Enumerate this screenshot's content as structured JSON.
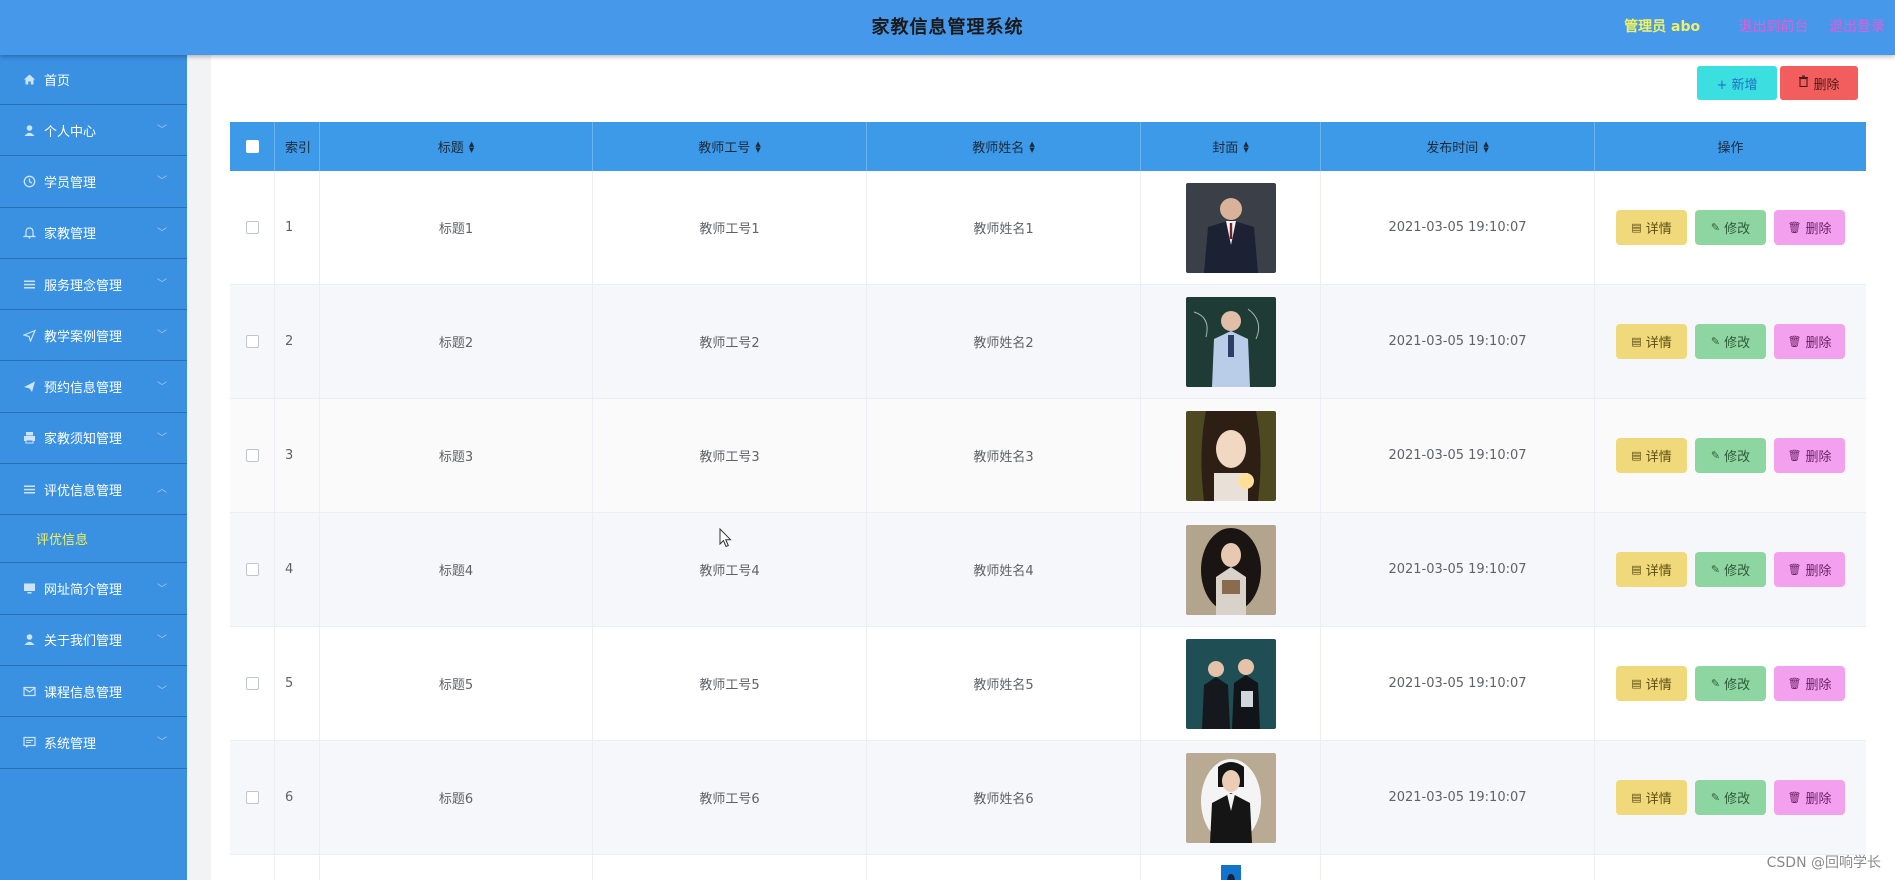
{
  "header": {
    "title": "家教信息管理系统",
    "admin": "管理员 abo",
    "back_link": "退出到前台",
    "logout_link": "退出登录"
  },
  "sidebar": {
    "items": [
      {
        "label": "首页",
        "icon": "home-icon"
      },
      {
        "label": "个人中心",
        "icon": "user-icon"
      },
      {
        "label": "学员管理",
        "icon": "clock-icon"
      },
      {
        "label": "家教管理",
        "icon": "bell-icon"
      },
      {
        "label": "服务理念管理",
        "icon": "list-icon"
      },
      {
        "label": "教学案例管理",
        "icon": "send-icon"
      },
      {
        "label": "预约信息管理",
        "icon": "plane-icon"
      },
      {
        "label": "家教须知管理",
        "icon": "printer-icon"
      },
      {
        "label": "评优信息管理",
        "icon": "list-icon"
      },
      {
        "label": "网址简介管理",
        "icon": "monitor-icon"
      },
      {
        "label": "关于我们管理",
        "icon": "user-icon"
      },
      {
        "label": "课程信息管理",
        "icon": "mail-icon"
      },
      {
        "label": "系统管理",
        "icon": "chat-icon"
      }
    ],
    "submenu": {
      "label": "评优信息"
    }
  },
  "toolbar": {
    "add_label": "+ 新增",
    "delete_label": "删除"
  },
  "table": {
    "headers": [
      "索引",
      "标题",
      "教师工号",
      "教师姓名",
      "封面",
      "发布时间",
      "操作"
    ],
    "rows": [
      {
        "index": "1",
        "title": "标题1",
        "teacher_no": "教师工号1",
        "teacher_name": "教师姓名1",
        "time": "2021-03-05 19:10:07"
      },
      {
        "index": "2",
        "title": "标题2",
        "teacher_no": "教师工号2",
        "teacher_name": "教师姓名2",
        "time": "2021-03-05 19:10:07"
      },
      {
        "index": "3",
        "title": "标题3",
        "teacher_no": "教师工号3",
        "teacher_name": "教师姓名3",
        "time": "2021-03-05 19:10:07"
      },
      {
        "index": "4",
        "title": "标题4",
        "teacher_no": "教师工号4",
        "teacher_name": "教师姓名4",
        "time": "2021-03-05 19:10:07"
      },
      {
        "index": "5",
        "title": "标题5",
        "teacher_no": "教师工号5",
        "teacher_name": "教师姓名5",
        "time": "2021-03-05 19:10:07"
      },
      {
        "index": "6",
        "title": "标题6",
        "teacher_no": "教师工号6",
        "teacher_name": "教师姓名6",
        "time": "2021-03-05 19:10:07"
      }
    ],
    "actions": {
      "detail": "详情",
      "edit": "修改",
      "delete": "删除"
    }
  },
  "watermark": "CSDN @回响学长",
  "colors": {
    "header_bg": "#4598ea",
    "sidebar_bg": "#3a91e2",
    "table_header_bg": "#3c9ae9",
    "admin_text": "#f1f163",
    "header_link": "#e65bd8",
    "btn_add": "#3cdfe0",
    "btn_delete": "#f25d5d",
    "op_detail": "#f0d97a",
    "op_edit": "#8ed6a1",
    "op_delete": "#f3a0ef"
  }
}
